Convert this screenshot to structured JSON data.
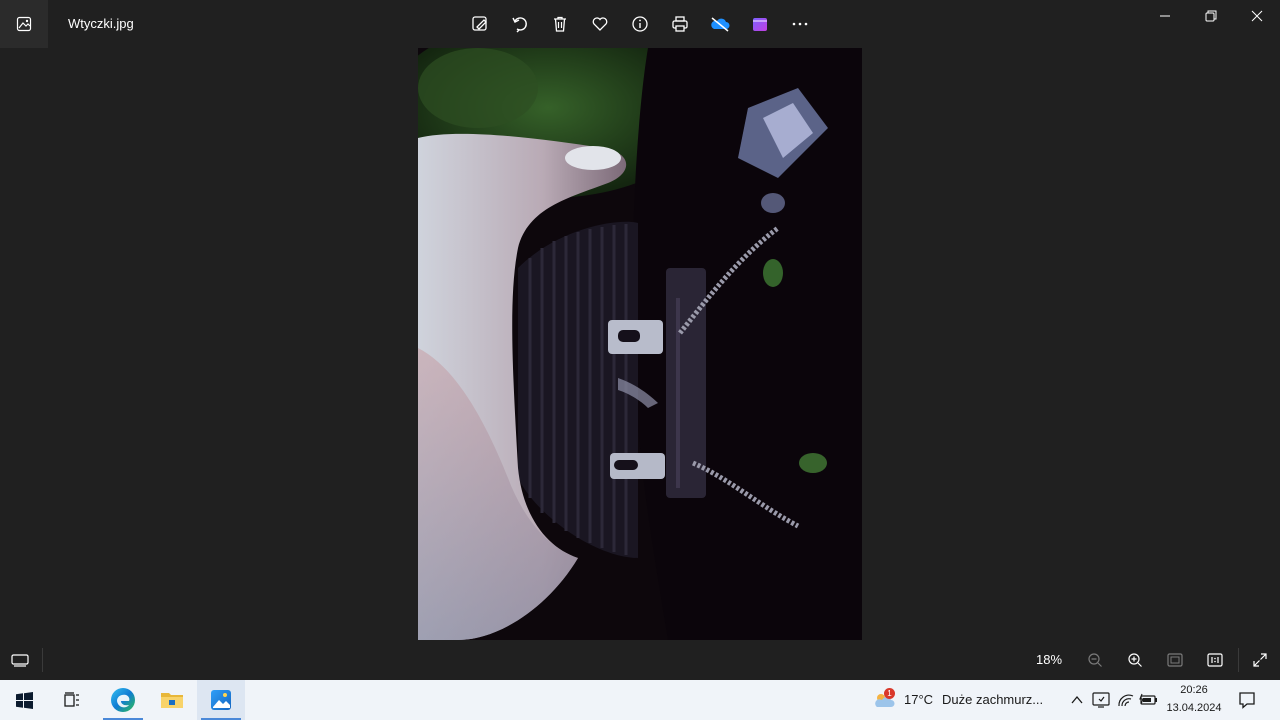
{
  "titlebar": {
    "file_name": "Wtyczki.jpg"
  },
  "toolbar": {
    "buttons": [
      {
        "name": "edit-image-button",
        "icon": "edit-image-icon"
      },
      {
        "name": "rotate-button",
        "icon": "rotate-icon"
      },
      {
        "name": "delete-button",
        "icon": "trash-icon"
      },
      {
        "name": "favorite-button",
        "icon": "heart-icon"
      },
      {
        "name": "file-info-button",
        "icon": "info-icon"
      },
      {
        "name": "print-button",
        "icon": "printer-icon"
      },
      {
        "name": "onedrive-button",
        "icon": "onedrive-off-icon"
      },
      {
        "name": "clipchamp-button",
        "icon": "clipchamp-icon"
      },
      {
        "name": "more-options-button",
        "icon": "ellipsis-icon"
      }
    ]
  },
  "bottombar": {
    "zoom_level": "18%"
  },
  "taskbar": {
    "weather_temp": "17°C",
    "weather_desc": "Duże zachmurz...",
    "weather_badge": "1",
    "clock_time": "20:26",
    "clock_date": "13.04.2024"
  },
  "colors": {
    "app_background": "#202020",
    "taskbar_background": "#f0f4f9",
    "accent": "#4a88d8"
  }
}
